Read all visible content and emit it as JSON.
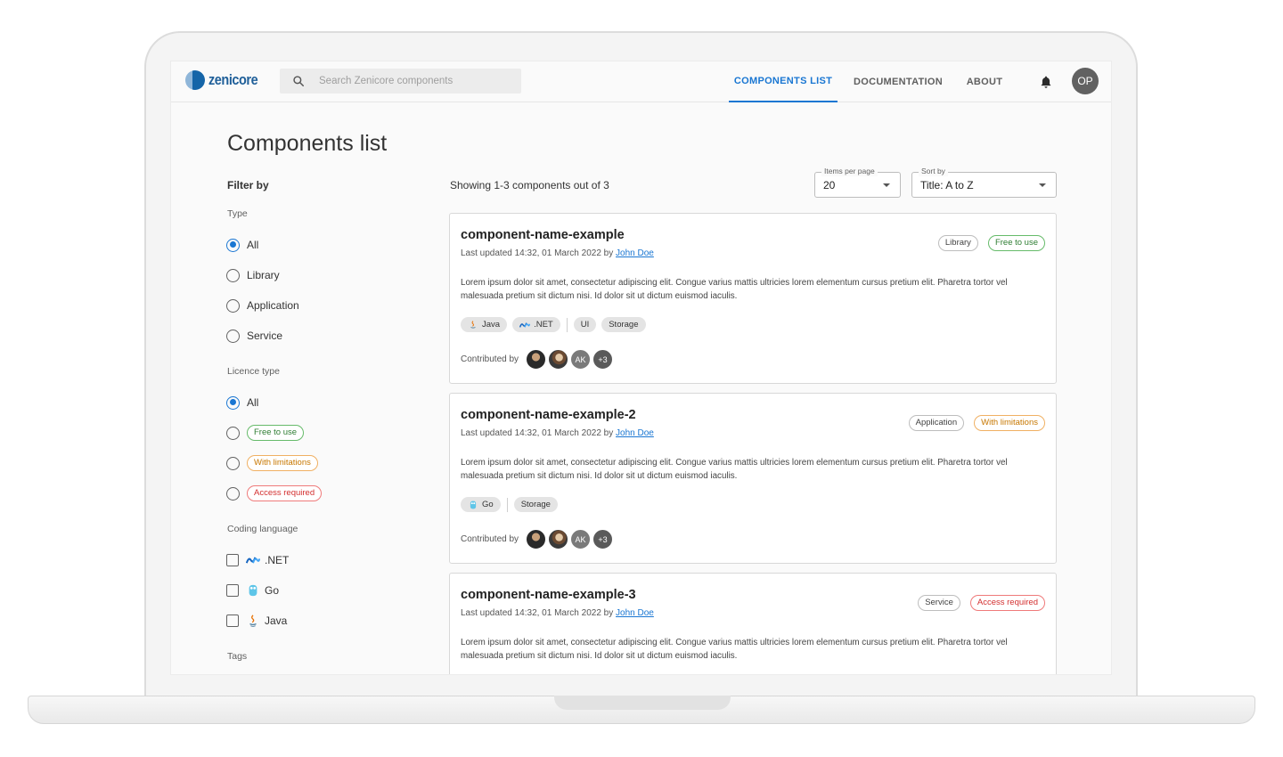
{
  "header": {
    "logo_text": "zenicore",
    "search_placeholder": "Search Zenicore components",
    "nav": [
      {
        "label": "COMPONENTS LIST",
        "active": true
      },
      {
        "label": "DOCUMENTATION",
        "active": false
      },
      {
        "label": "ABOUT",
        "active": false
      }
    ],
    "user_initials": "OP"
  },
  "page_title": "Components list",
  "filters": {
    "title": "Filter by",
    "type": {
      "label": "Type",
      "options": [
        "All",
        "Library",
        "Application",
        "Service"
      ],
      "selected": "All"
    },
    "licence": {
      "label": "Licence type",
      "options": [
        "All",
        "Free to use",
        "With limitations",
        "Access required"
      ],
      "selected": "All"
    },
    "coding_language": {
      "label": "Coding language",
      "options": [
        ".NET",
        "Go",
        "Java"
      ]
    },
    "tags": {
      "label": "Tags"
    }
  },
  "list": {
    "showing": "Showing 1-3 components out of 3",
    "items_per_page_label": "Items per page",
    "items_per_page_value": "20",
    "sort_label": "Sort by",
    "sort_value": "Title: A to Z",
    "contributed_label": "Contributed by",
    "description": "Lorem ipsum dolor sit amet, consectetur adipiscing elit. Congue varius mattis ultricies lorem elementum cursus pretium elit. Pharetra tortor vel malesuada pretium sit dictum nisi. Id dolor sit ut dictum euismod iaculis.",
    "cards": [
      {
        "title": "component-name-example",
        "updated": "Last updated 14:32, 01 March 2022 by",
        "author": "John Doe",
        "type_pill": "Library",
        "licence_pill": "Free to use",
        "languages": [
          "Java",
          ".NET"
        ],
        "tags": [
          "UI",
          "Storage"
        ],
        "contributors": [
          "AK",
          "+3"
        ]
      },
      {
        "title": "component-name-example-2",
        "updated": "Last updated 14:32, 01 March 2022 by",
        "author": "John Doe",
        "type_pill": "Application",
        "licence_pill": "With limitations",
        "languages": [
          "Go"
        ],
        "tags": [
          "Storage"
        ],
        "contributors": [
          "AK",
          "+3"
        ]
      },
      {
        "title": "component-name-example-3",
        "updated": "Last updated 14:32, 01 March 2022 by",
        "author": "John Doe",
        "type_pill": "Service",
        "licence_pill": "Access required"
      }
    ]
  },
  "colors": {
    "primary": "#1976d2",
    "free": "#2e7d32",
    "limited": "#c77700",
    "access": "#d32f2f"
  }
}
